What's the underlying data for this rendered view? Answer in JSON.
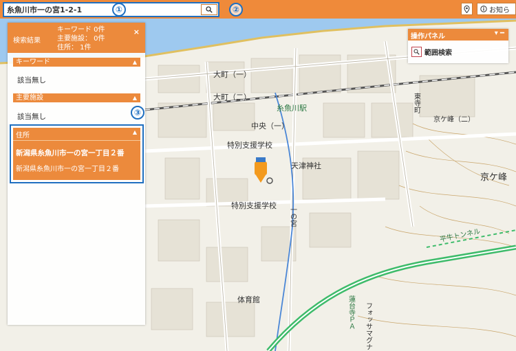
{
  "search": {
    "value": "糸魚川市一の宮1-2-1"
  },
  "callouts": [
    "①",
    "②",
    "③"
  ],
  "top_buttons": {
    "location_icon": "map-pin-icon",
    "notice_label": "お知ら"
  },
  "results": {
    "title": "検索結果",
    "counts": [
      "キーワード 0件",
      "主要施設：  0件",
      "住所：       1件"
    ],
    "close_symbol": "×",
    "sections": {
      "keyword": {
        "label": "キーワード",
        "result": "該当無し"
      },
      "facility": {
        "label": "主要施設",
        "result": "該当無し"
      },
      "address": {
        "label": "住所",
        "items": [
          "新潟県糸魚川市一の宮一丁目２番",
          "新潟県糸魚川市一の宮一丁目２番"
        ]
      }
    }
  },
  "op_panel": {
    "title": "操作パネル",
    "controls": "▾ ━",
    "items": [
      "範囲検索"
    ]
  },
  "map_labels": {
    "station": "糸魚川駅",
    "tenzu": "天津神社",
    "school1": "特別支援学校",
    "school2": "特別支援学校",
    "gymnasium": "体育館",
    "kyogamine": "京ケ峰",
    "kyogamine2": "京ケ峰（二）",
    "tunnel": "平牛トンネル",
    "omachi": "大町（一）",
    "omachi2": "大町（二）",
    "chuo": "中央（一）",
    "ichinomiya": "一の宮",
    "fossa": "フォッサマグナ",
    "rendaiji": "蓮台寺ＰＡ",
    "higashi": "東寺町"
  },
  "colors": {
    "accent": "#ec8a3c",
    "callout": "#1f6fc0",
    "sea": "#9ec9ef",
    "highway": "#3dbb6a",
    "road": "#ffffff"
  }
}
